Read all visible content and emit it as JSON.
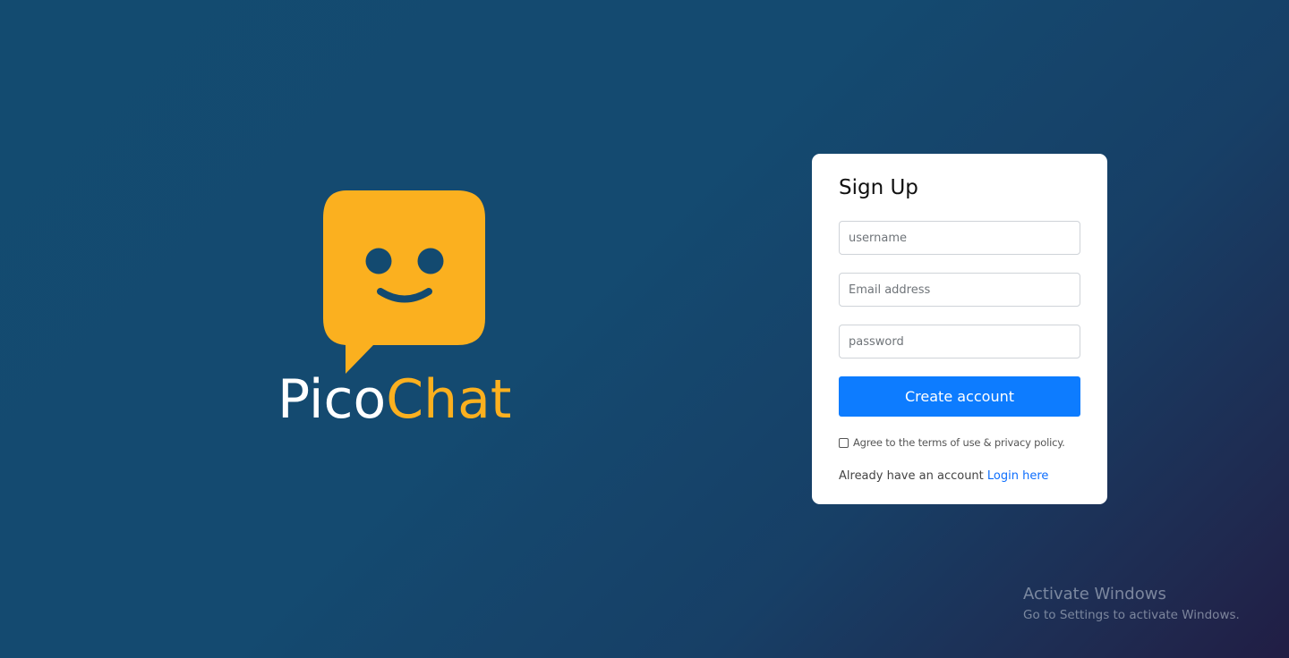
{
  "brand": {
    "name_part1": "Pico",
    "name_part2": "Chat",
    "accent_color": "#fbb01f",
    "logo_icon": "smiling-chat-bubble-icon"
  },
  "signup": {
    "title": "Sign Up",
    "username_placeholder": "username",
    "email_placeholder": "Email address",
    "password_placeholder": "password",
    "submit_label": "Create account",
    "terms_label": "Agree to the terms of use & privacy policy.",
    "terms_checked": false,
    "already_text": "Already have an account",
    "login_link": "Login here",
    "button_color": "#0d7cff"
  },
  "watermark": {
    "title": "Activate Windows",
    "subtitle": "Go to Settings to activate Windows."
  }
}
